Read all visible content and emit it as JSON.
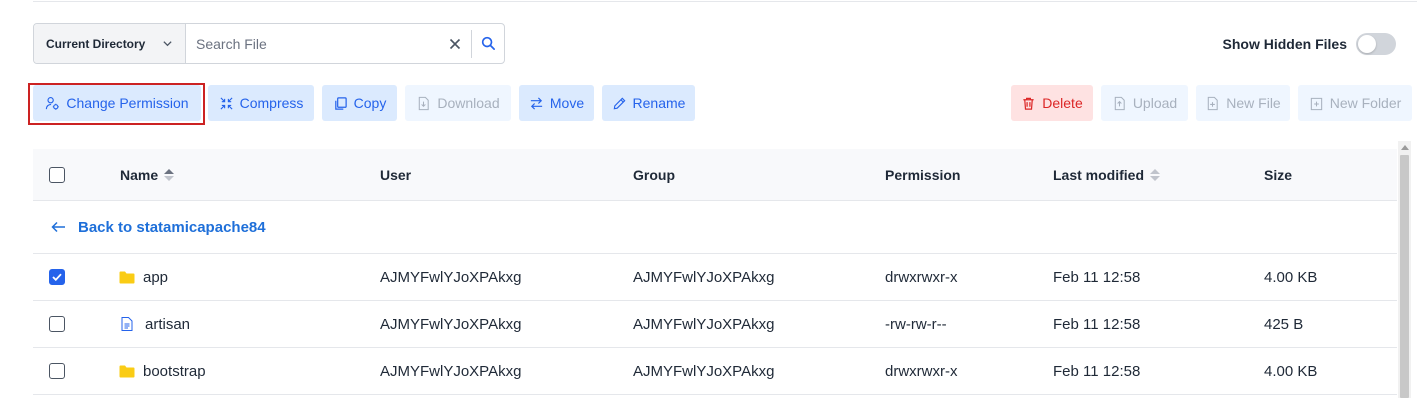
{
  "search": {
    "directory_label": "Current Directory",
    "placeholder": "Search File",
    "value": ""
  },
  "hidden_files_label": "Show Hidden Files",
  "hidden_files_on": false,
  "toolbar": {
    "change_permission": "Change Permission",
    "compress": "Compress",
    "copy": "Copy",
    "download": "Download",
    "move": "Move",
    "rename": "Rename",
    "delete": "Delete",
    "upload": "Upload",
    "new_file": "New File",
    "new_folder": "New Folder"
  },
  "table": {
    "headers": {
      "name": "Name",
      "user": "User",
      "group": "Group",
      "permission": "Permission",
      "last_modified": "Last modified",
      "size": "Size"
    },
    "back_label": "Back to statamicapache84",
    "rows": [
      {
        "name": "app",
        "type": "folder",
        "checked": true,
        "user": "AJMYFwlYJoXPAkxg",
        "group": "AJMYFwlYJoXPAkxg",
        "permission": "drwxrwxr-x",
        "modified": "Feb 11 12:58",
        "size": "4.00 KB"
      },
      {
        "name": "artisan",
        "type": "file",
        "checked": false,
        "user": "AJMYFwlYJoXPAkxg",
        "group": "AJMYFwlYJoXPAkxg",
        "permission": "-rw-rw-r--",
        "modified": "Feb 11 12:58",
        "size": "425 B"
      },
      {
        "name": "bootstrap",
        "type": "folder",
        "checked": false,
        "user": "AJMYFwlYJoXPAkxg",
        "group": "AJMYFwlYJoXPAkxg",
        "permission": "drwxrwxr-x",
        "modified": "Feb 11 12:58",
        "size": "4.00 KB"
      }
    ]
  },
  "colors": {
    "accent": "#2563eb",
    "folder": "#facc15",
    "danger": "#dc2626"
  }
}
